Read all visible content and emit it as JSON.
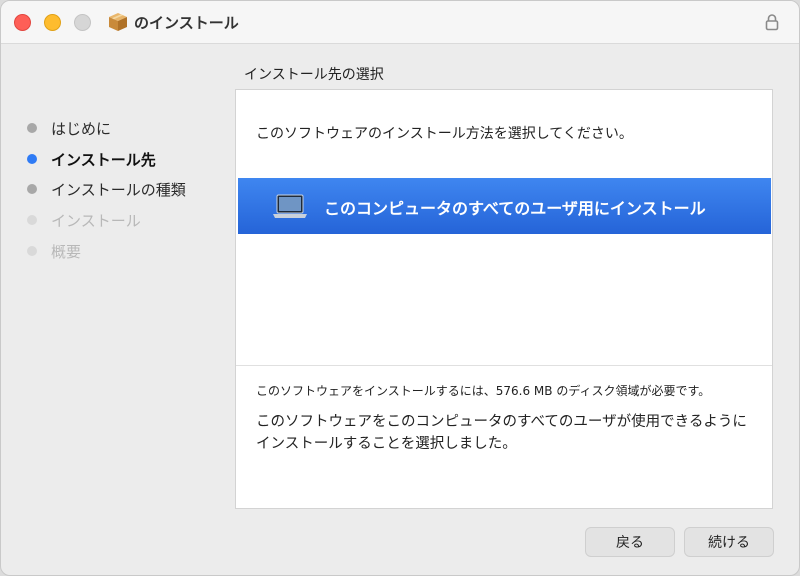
{
  "window": {
    "title": "のインストール",
    "icons": {
      "app": "package-icon",
      "lock": "lock-icon"
    }
  },
  "sidebar": {
    "steps": [
      {
        "label": "はじめに",
        "state": "done"
      },
      {
        "label": "インストール先",
        "state": "current"
      },
      {
        "label": "インストールの種類",
        "state": "done"
      },
      {
        "label": "インストール",
        "state": "future"
      },
      {
        "label": "概要",
        "state": "future"
      }
    ]
  },
  "main": {
    "section_title": "インストール先の選択",
    "prompt": "このソフトウェアのインストール方法を選択してください。",
    "option": {
      "label": "このコンピュータのすべてのユーザ用にインストール",
      "icon": "laptop-icon",
      "selected": true
    },
    "space_note": "このソフトウェアをインストールするには、576.6 MB のディスク領域が必要です。",
    "selection_description": "このソフトウェアをこのコンピュータのすべてのユーザが使用できるようにインストールすることを選択しました。"
  },
  "buttons": {
    "back": "戻る",
    "continue": "続ける"
  },
  "colors": {
    "accent": "#2f7bf5",
    "selection": "#2f6fe3",
    "close": "#fe5f57",
    "minimize": "#febc2e",
    "zoom": "#d6d6d6"
  }
}
